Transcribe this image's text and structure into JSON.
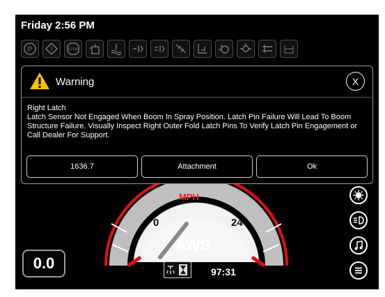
{
  "status_bar": {
    "clock": "Friday 2:56 PM"
  },
  "indicators": [
    {
      "icon": "parking-brake-icon"
    },
    {
      "icon": "warning-triangle-icon"
    },
    {
      "icon": "stop-icon"
    },
    {
      "icon": "hydraulic-pressure-icon"
    },
    {
      "icon": "coolant-level-icon"
    },
    {
      "icon": "boom-left-icon"
    },
    {
      "icon": "boom-right-icon"
    },
    {
      "icon": "boom-fold-icon"
    },
    {
      "icon": "spray-boom-icon"
    },
    {
      "icon": "engine-icon"
    },
    {
      "icon": "transmission-icon"
    },
    {
      "icon": "hitch-icon"
    },
    {
      "icon": "tank-icon"
    }
  ],
  "dialog": {
    "title": "Warning",
    "message_title": "Right Latch",
    "message": "Latch Sensor Not Engaged When Boom In Spray Position.  Latch Pin Failure Will Lead To Boom Structure Failure.  Visually Inspect Right Outer Fold Latch Pins To Verify Latch Pin Engagement or Call Dealer For Support.",
    "buttons": [
      "1636.7",
      "Attachment",
      "Ok"
    ],
    "colors": {
      "warning": "#f2c200"
    }
  },
  "gauge": {
    "unit": "MPH",
    "scale_min": "0",
    "scale_label": "24",
    "mode": "AWS",
    "colors": {
      "redline": "#e01010",
      "face": "#f2f2f2"
    }
  },
  "readout": {
    "value": "0.0"
  },
  "timer": {
    "value": "97:31",
    "icon": "spray-timer-icon"
  },
  "side_buttons": [
    "brightness-icon",
    "headlight-icon",
    "music-icon",
    "menu-icon"
  ]
}
